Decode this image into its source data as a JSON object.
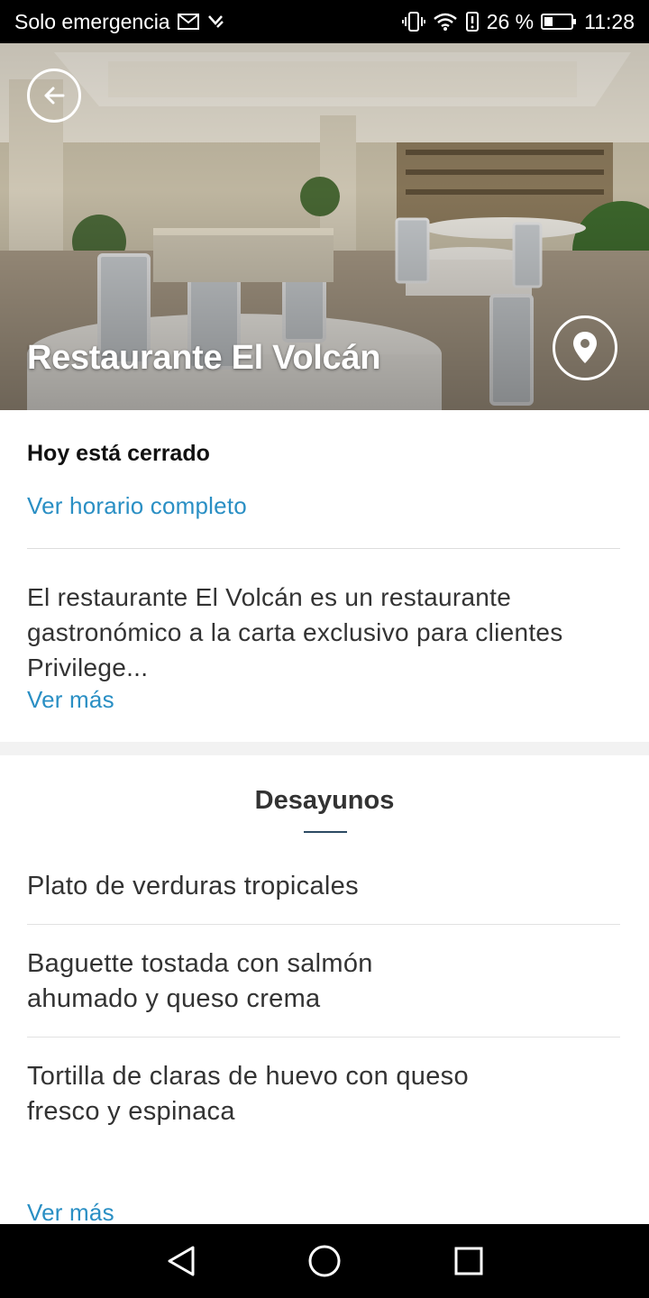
{
  "status_bar": {
    "carrier": "Solo emergencia",
    "battery": "26 %",
    "time": "11:28",
    "icons": [
      "mail-icon",
      "signal-status-icon",
      "vibrate-icon",
      "wifi-icon",
      "battery-alert-icon",
      "battery-icon"
    ]
  },
  "hero": {
    "title": "Restaurante El Volcán",
    "back_icon": "arrow-left-icon",
    "location_icon": "map-pin-icon"
  },
  "info": {
    "status": "Hoy está cerrado",
    "hours_link": "Ver horario completo",
    "description": "El restaurante El Volcán es un restaurante gastronómico a la carta exclusivo para clientes Privilege...",
    "more_link": "Ver más"
  },
  "menu": {
    "heading": "Desayunos",
    "items": [
      {
        "line1": "Plato de verduras tropicales",
        "line2": ""
      },
      {
        "line1": "Baguette tostada con salmón",
        "line2": "ahumado y queso crema"
      },
      {
        "line1": "Tortilla de claras de huevo con queso",
        "line2": "fresco y espinaca"
      }
    ],
    "more_link": "Ver más"
  },
  "nav_bar": {
    "icons": [
      "back-triangle-icon",
      "home-circle-icon",
      "recents-square-icon"
    ]
  },
  "colors": {
    "link": "#2a8fc4",
    "text": "#333333",
    "accent_underline": "#2c4a63"
  }
}
